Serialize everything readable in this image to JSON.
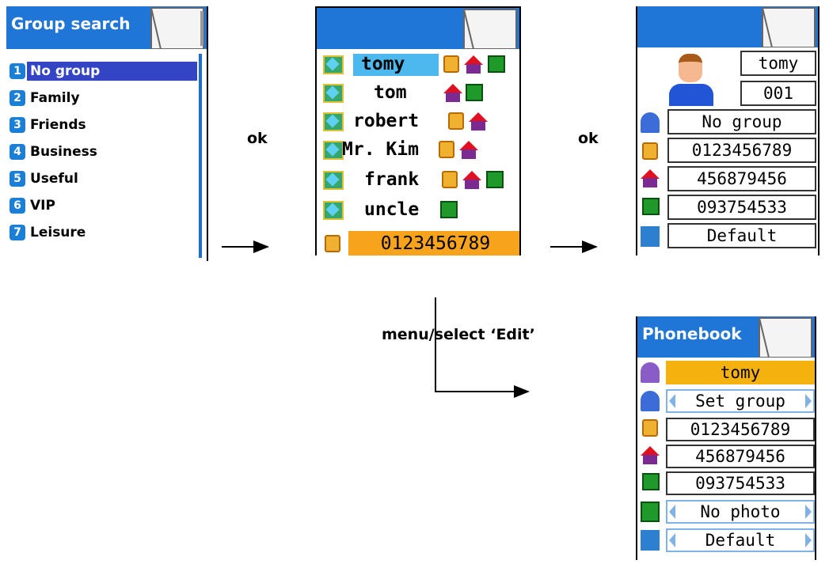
{
  "group_search": {
    "title": "Group search",
    "items": [
      {
        "num": "1",
        "label": "No group"
      },
      {
        "num": "2",
        "label": "Family"
      },
      {
        "num": "3",
        "label": "Friends"
      },
      {
        "num": "4",
        "label": "Business"
      },
      {
        "num": "5",
        "label": "Useful"
      },
      {
        "num": "6",
        "label": "VIP"
      },
      {
        "num": "7",
        "label": "Leisure"
      }
    ]
  },
  "contact_list": {
    "contacts": [
      {
        "name": "tomy"
      },
      {
        "name": "tom"
      },
      {
        "name": "robert"
      },
      {
        "name": "Mr. Kim"
      },
      {
        "name": "frank"
      },
      {
        "name": "uncle"
      }
    ],
    "selected_number": "0123456789"
  },
  "contact_detail": {
    "name": "tomy",
    "index": "001",
    "group": "No group",
    "mobile": "0123456789",
    "home": "456879456",
    "office": "093754533",
    "ringtone": "Default"
  },
  "phonebook_edit": {
    "title": "Phonebook",
    "name": "tomy",
    "group": "Set group",
    "mobile": "0123456789",
    "home": "456879456",
    "office": "093754533",
    "photo": "No photo",
    "ringtone": "Default"
  },
  "annotations": {
    "ok_1": "ok",
    "ok_2": "ok",
    "edit_step": "menu/select ‘Edit’"
  },
  "colors": {
    "titlebar": "#1f76d6",
    "selection": "#3344c4",
    "highlight": "#4db8ee",
    "orange": "#f7a41c"
  }
}
